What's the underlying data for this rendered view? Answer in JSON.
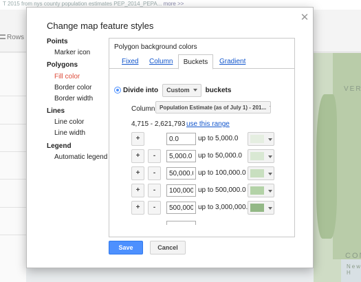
{
  "background": {
    "top_text": "T 2015 from nys county population estimates PEP_2014_PEPA...",
    "top_more": "more >>",
    "rows_label": "Rows",
    "map_labels": [
      "VER",
      "CONN",
      "New H"
    ]
  },
  "dialog": {
    "title": "Change map feature styles",
    "close_icon": "close-icon",
    "nav": {
      "points": {
        "heading": "Points",
        "items": [
          "Marker icon"
        ]
      },
      "polygons": {
        "heading": "Polygons",
        "items": [
          "Fill color",
          "Border color",
          "Border width"
        ]
      },
      "lines": {
        "heading": "Lines",
        "items": [
          "Line color",
          "Line width"
        ]
      },
      "legend": {
        "heading": "Legend",
        "items": [
          "Automatic legend"
        ]
      },
      "active_item": "Fill color"
    },
    "panel": {
      "title": "Polygon background colors",
      "tabs": [
        "Fixed",
        "Column",
        "Buckets",
        "Gradient"
      ],
      "active_tab": "Buckets",
      "divide_into_label": "Divide into",
      "divide_count": "Custom",
      "buckets_label": "buckets",
      "column_label": "Column",
      "column_value": "Population Estimate (as of July 1) - 201...",
      "range_text": "4,715 - 2,621,793",
      "range_link": "use this range",
      "buckets": [
        {
          "from": "0.0",
          "upto": "up to 5,000.0",
          "color": "#e5eee1",
          "has_minus": false
        },
        {
          "from": "5,000.0",
          "upto": "up to 50,000.0",
          "color": "#d9e8d3",
          "has_minus": true
        },
        {
          "from": "50,000.0",
          "upto": "up to 100,000.0",
          "color": "#c8dfbf",
          "has_minus": true
        },
        {
          "from": "100,000.0",
          "upto": "up to 500,000.0",
          "color": "#b3d2a7",
          "has_minus": true
        },
        {
          "from": "500,000.0",
          "upto": "up to 3,000,000.0",
          "color": "#93b886",
          "has_minus": true
        }
      ],
      "plus_label": "+",
      "minus_label": "-"
    },
    "save_label": "Save",
    "cancel_label": "Cancel"
  },
  "colors": {
    "accent": "#4d90fe",
    "link": "#1155cc",
    "active_nav": "#dd4b39"
  }
}
